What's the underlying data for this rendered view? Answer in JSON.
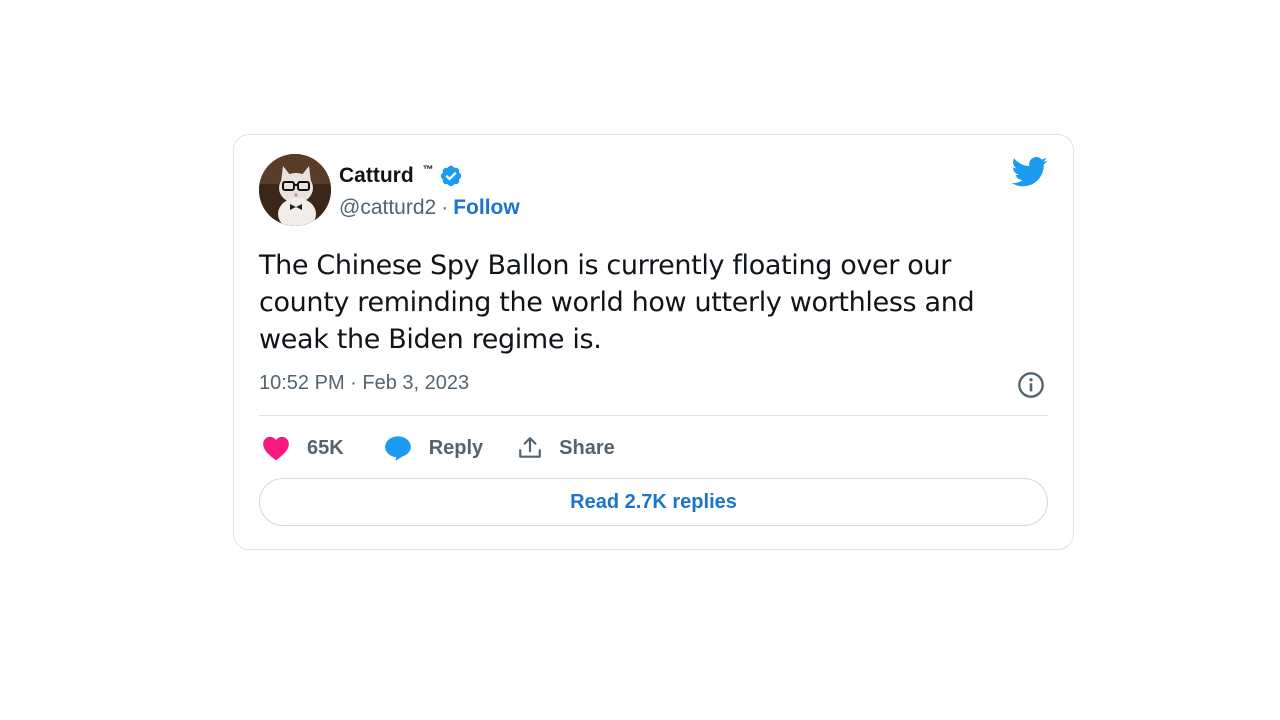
{
  "author": {
    "display_name": "Catturd",
    "tm": "™",
    "handle": "@catturd2",
    "separator": "·",
    "follow_label": "Follow",
    "verified": true
  },
  "tweet": {
    "text": "The Chinese Spy Ballon is currently floating over our county reminding the world how utterly worthless and weak the Biden regime is.",
    "timestamp": "10:52 PM · Feb 3, 2023"
  },
  "actions": {
    "like_count": "65K",
    "reply_label": "Reply",
    "share_label": "Share"
  },
  "read_replies_label": "Read 2.7K replies",
  "icons": {
    "brand": "twitter-bird-icon",
    "verified": "verified-badge-icon",
    "info": "info-icon",
    "like": "heart-icon",
    "reply": "speech-bubble-icon",
    "share": "share-upload-icon"
  },
  "colors": {
    "accent_blue": "#1d74c9",
    "twitter_blue": "#1d9bf0",
    "like_pink": "#f91880",
    "text_primary": "#0f1419",
    "text_secondary": "#536471",
    "border": "#dfe3e7"
  }
}
